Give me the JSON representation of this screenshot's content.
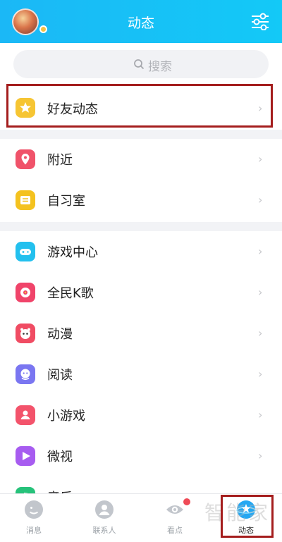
{
  "header": {
    "title": "动态"
  },
  "search": {
    "placeholder": "搜索"
  },
  "sections": [
    {
      "items": [
        {
          "label": "好友动态",
          "icon": "star-friends-icon",
          "color": "#f6c533"
        }
      ]
    },
    {
      "items": [
        {
          "label": "附近",
          "icon": "location-pin-icon",
          "color": "#f0536a"
        },
        {
          "label": "自习室",
          "icon": "study-room-icon",
          "color": "#f4c21f"
        }
      ]
    },
    {
      "items": [
        {
          "label": "游戏中心",
          "icon": "gamepad-icon",
          "color": "#23c0ee"
        },
        {
          "label": "全民K歌",
          "icon": "karaoke-icon",
          "color": "#f0446a"
        },
        {
          "label": "动漫",
          "icon": "anime-icon",
          "color": "#f04c63"
        },
        {
          "label": "阅读",
          "icon": "reading-icon",
          "color": "#7a76f1"
        },
        {
          "label": "小游戏",
          "icon": "mini-game-icon",
          "color": "#f3536b"
        },
        {
          "label": "微视",
          "icon": "weishi-icon",
          "color": "#a75cf0"
        },
        {
          "label": "音乐",
          "icon": "music-icon",
          "color": "#26c27a"
        }
      ]
    }
  ],
  "tabbar": {
    "tabs": [
      {
        "label": "消息",
        "icon": "message-icon"
      },
      {
        "label": "联系人",
        "icon": "contacts-icon"
      },
      {
        "label": "看点",
        "icon": "eye-icon"
      },
      {
        "label": "动态",
        "icon": "star-planet-icon"
      }
    ]
  },
  "watermark": "智能家"
}
